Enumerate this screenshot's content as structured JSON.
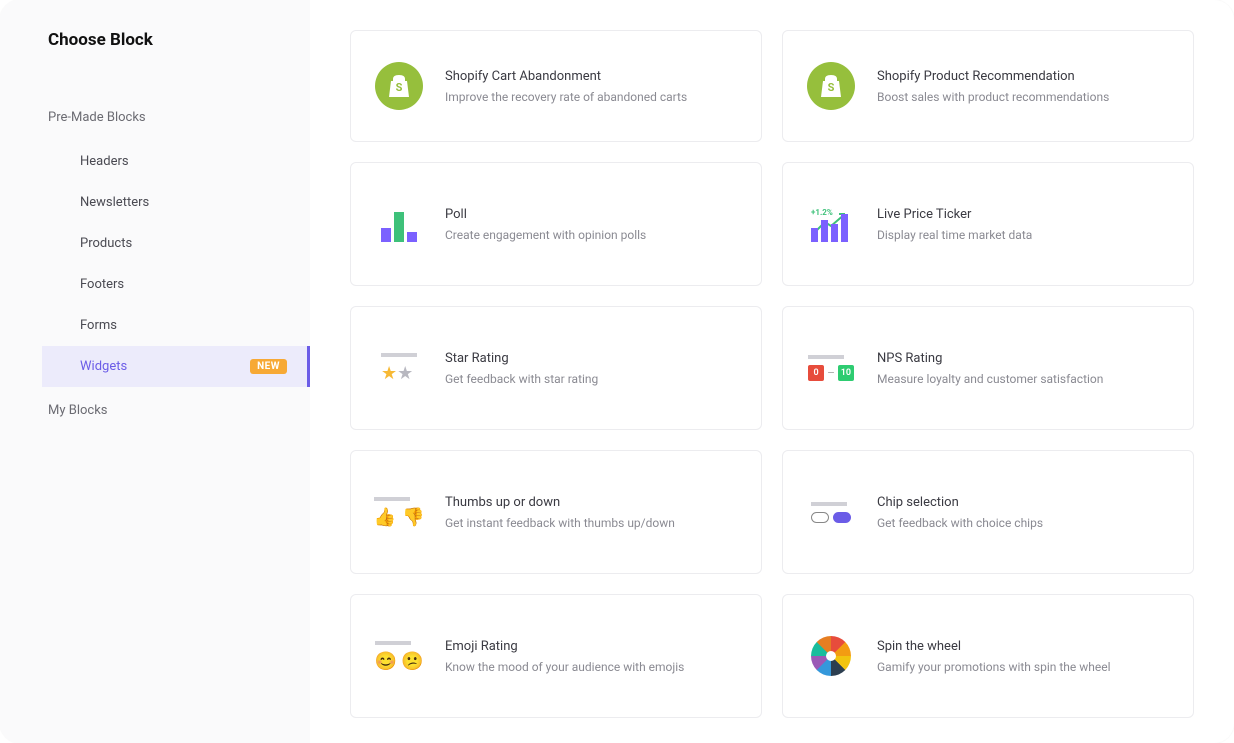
{
  "sidebar": {
    "title": "Choose Block",
    "section_premade": "Pre-Made Blocks",
    "section_myblocks": "My Blocks",
    "items": {
      "headers": "Headers",
      "newsletters": "Newsletters",
      "products": "Products",
      "footers": "Footers",
      "forms": "Forms",
      "widgets": "Widgets"
    },
    "badge_new": "NEW"
  },
  "widgets": {
    "shopify_cart": {
      "title": "Shopify Cart Abandonment",
      "desc": "Improve the recovery rate of abandoned carts"
    },
    "shopify_rec": {
      "title": "Shopify Product Recommendation",
      "desc": "Boost sales with product recommendations"
    },
    "poll": {
      "title": "Poll",
      "desc": "Create engagement with opinion polls"
    },
    "ticker": {
      "title": "Live Price Ticker",
      "desc": "Display real time market data"
    },
    "star": {
      "title": "Star Rating",
      "desc": "Get feedback with star rating"
    },
    "nps": {
      "title": "NPS Rating",
      "desc": "Measure loyalty and customer satisfaction"
    },
    "thumbs": {
      "title": "Thumbs up or down",
      "desc": "Get instant feedback with thumbs up/down"
    },
    "chip": {
      "title": "Chip selection",
      "desc": "Get feedback with choice chips"
    },
    "emoji": {
      "title": "Emoji Rating",
      "desc": "Know the mood of your audience with emojis"
    },
    "wheel": {
      "title": "Spin the wheel",
      "desc": "Gamify your promotions with spin the wheel"
    }
  },
  "icons": {
    "nps_low": "0",
    "nps_dash": "–",
    "nps_high": "10",
    "ticker_delta": "+1.2%"
  }
}
